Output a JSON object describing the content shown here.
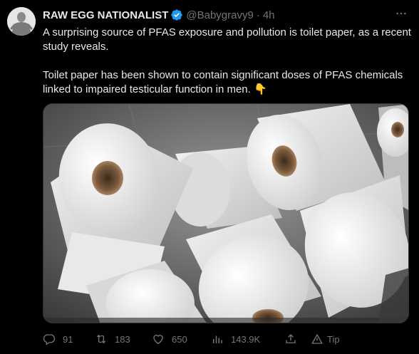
{
  "author": {
    "name": "RAW EGG NATIONALIST",
    "handle": "@Babygravy9",
    "separator": "·",
    "time": "4h"
  },
  "tweet": {
    "paragraph1": "A surprising source of PFAS exposure and pollution is toilet paper, as a recent study reveals.",
    "paragraph2": "Toilet paper has been shown to contain significant doses of PFAS chemicals linked to impaired testicular function in men. 👇"
  },
  "media": {
    "subject": "toilet paper rolls"
  },
  "actions": {
    "reply_count": "91",
    "retweet_count": "183",
    "like_count": "650",
    "view_count": "143.9K",
    "tip_label": "Tip"
  },
  "icons": {
    "verified": "verified-badge-icon",
    "more": "more-icon",
    "reply": "reply-icon",
    "retweet": "retweet-icon",
    "like": "heart-icon",
    "views": "views-icon",
    "share": "share-icon",
    "tip": "tip-icon"
  },
  "colors": {
    "background": "#000000",
    "text": "#e7e9ea",
    "muted": "#71767b",
    "verified": "#1d9bf0"
  }
}
